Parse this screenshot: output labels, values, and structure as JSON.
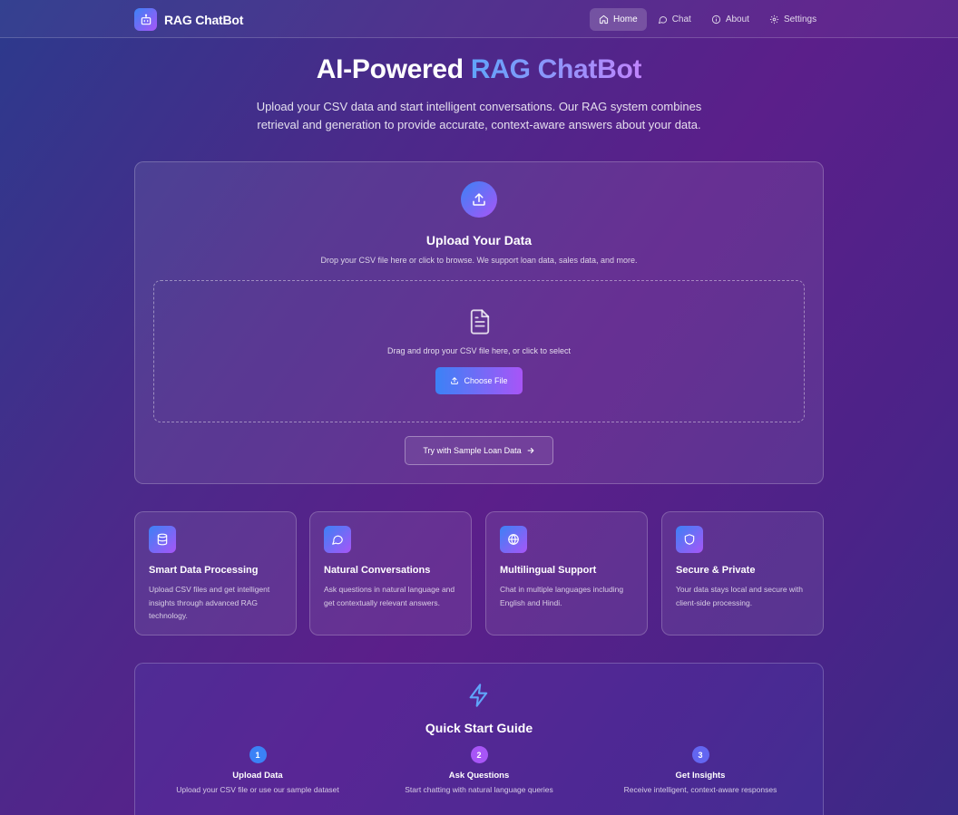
{
  "nav": {
    "brand": "RAG ChatBot",
    "links": [
      {
        "label": "Home",
        "icon": "home-icon",
        "active": true
      },
      {
        "label": "Chat",
        "icon": "chat-icon"
      },
      {
        "label": "About",
        "icon": "info-icon"
      },
      {
        "label": "Settings",
        "icon": "gear-icon"
      }
    ]
  },
  "hero": {
    "title_prefix": "AI-Powered ",
    "title_accent": "RAG ChatBot",
    "subtitle": "Upload your CSV data and start intelligent conversations. Our RAG system combines retrieval and generation to provide accurate, context-aware answers about your data."
  },
  "upload": {
    "title": "Upload Your Data",
    "description": "Drop your CSV file here or click to browse. We support loan data, sales data, and more.",
    "drop_text": "Drag and drop your CSV file here, or click to select",
    "choose_label": "Choose File",
    "sample_label": "Try with Sample Loan Data"
  },
  "features": [
    {
      "title": "Smart Data Processing",
      "desc": "Upload CSV files and get intelligent insights through advanced RAG technology.",
      "icon": "database-icon"
    },
    {
      "title": "Natural Conversations",
      "desc": "Ask questions in natural language and get contextually relevant answers.",
      "icon": "chat-bubble-icon"
    },
    {
      "title": "Multilingual Support",
      "desc": "Chat in multiple languages including English and Hindi.",
      "icon": "globe-icon"
    },
    {
      "title": "Secure & Private",
      "desc": "Your data stays local and secure with client-side processing.",
      "icon": "shield-icon"
    }
  ],
  "quick_start": {
    "title": "Quick Start Guide",
    "steps": [
      {
        "num": "1",
        "title": "Upload Data",
        "desc": "Upload your CSV file or use our sample dataset",
        "color": "#3b82f6"
      },
      {
        "num": "2",
        "title": "Ask Questions",
        "desc": "Start chatting with natural language queries",
        "color": "#a855f7"
      },
      {
        "num": "3",
        "title": "Get Insights",
        "desc": "Receive intelligent, context-aware responses",
        "color": "#6366f1"
      }
    ]
  },
  "colors": {
    "accent_blue": "#3b82f6",
    "accent_purple": "#a855f7"
  }
}
